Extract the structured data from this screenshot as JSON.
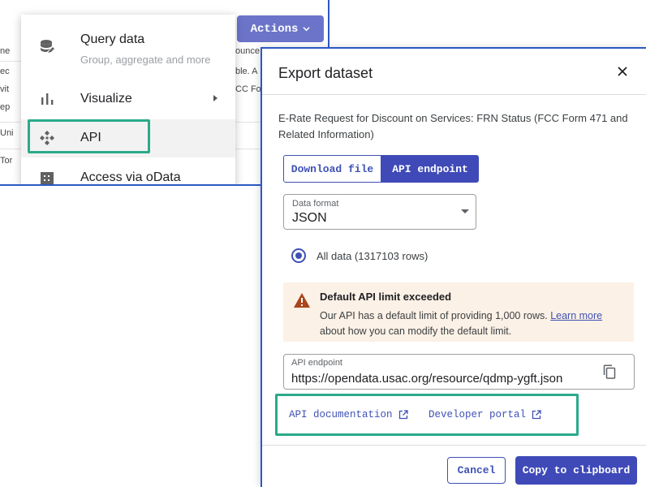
{
  "colors": {
    "accent": "#3f4ab8",
    "highlight_box": "#2aaa8a",
    "frame": "#2b59c3",
    "warning_bg": "#fcf1e6"
  },
  "background": {
    "left_fragments": [
      "ne",
      "ec",
      "vit",
      "ep",
      "Uni",
      "Tor"
    ],
    "right_fragments": [
      "ounce",
      "ble. A",
      "CC Fo"
    ]
  },
  "menu": {
    "actions_label": "Actions",
    "items": [
      {
        "icon": "database-icon",
        "label": "Query data",
        "sublabel": "Group, aggregate and more"
      },
      {
        "icon": "bar-chart-icon",
        "label": "Visualize",
        "has_submenu": true
      },
      {
        "icon": "api-icon",
        "label": "API",
        "highlighted": true
      },
      {
        "icon": "grid-icon",
        "label": "Access via oData"
      }
    ]
  },
  "dialog": {
    "title": "Export dataset",
    "description": "E-Rate Request for Discount on Services: FRN Status (FCC Form 471 and Related Information)",
    "tabs": [
      "Download file",
      "API endpoint"
    ],
    "active_tab": "API endpoint",
    "data_format": {
      "label": "Data format",
      "value": "JSON"
    },
    "scope_option": "All data (1317103 rows)",
    "warning": {
      "title": "Default API limit exceeded",
      "body_before": "Our API has a default limit of providing 1,000 rows. ",
      "link": "Learn more",
      "body_after": " about how you can modify the default limit."
    },
    "endpoint": {
      "label": "API endpoint",
      "value": "https://opendata.usac.org/resource/qdmp-ygft.json"
    },
    "links": {
      "docs": "API documentation",
      "portal": "Developer portal"
    },
    "buttons": {
      "cancel": "Cancel",
      "copy": "Copy to clipboard"
    }
  }
}
